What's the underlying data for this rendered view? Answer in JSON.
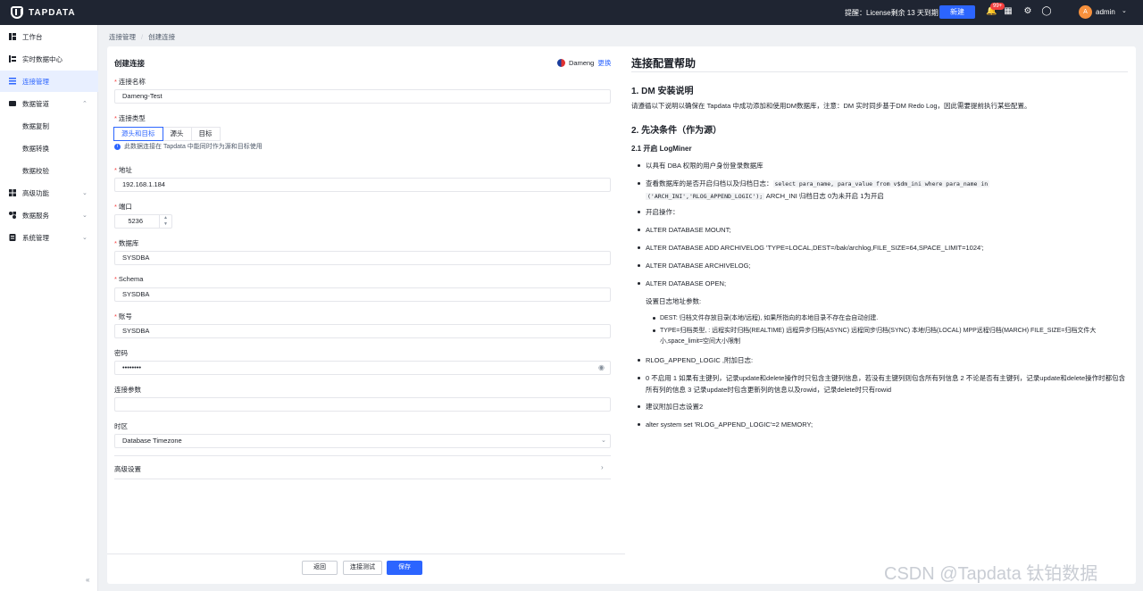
{
  "topbar": {
    "logo": "TAPDATA",
    "license": "提醒：License剩余 13 天到期",
    "new_label": "新建",
    "badge": "99+",
    "user": "admin",
    "avatar_letter": "A"
  },
  "sidebar": {
    "items": [
      {
        "label": "工作台"
      },
      {
        "label": "实时数据中心"
      },
      {
        "label": "连接管理"
      },
      {
        "label": "数据管道"
      },
      {
        "label": "数据复制"
      },
      {
        "label": "数据转换"
      },
      {
        "label": "数据校验"
      },
      {
        "label": "高级功能"
      },
      {
        "label": "数据服务"
      },
      {
        "label": "系统管理"
      }
    ]
  },
  "breadcrumb": [
    "连接管理",
    "创建连接"
  ],
  "form": {
    "title": "创建连接",
    "db_type": "Dameng",
    "change": "更换",
    "name_label": "连接名称",
    "name_value": "Dameng-Test",
    "type_label": "连接类型",
    "type_options": [
      "源头和目标",
      "源头",
      "目标"
    ],
    "type_hint": "此数据连接在 Tapdata 中能同时作为源和目标使用",
    "host_label": "地址",
    "host_value": "192.168.1.184",
    "port_label": "端口",
    "port_value": "5236",
    "db_label": "数据库",
    "db_value": "SYSDBA",
    "schema_label": "Schema",
    "schema_value": "SYSDBA",
    "user_label": "账号",
    "user_value": "SYSDBA",
    "pwd_label": "密码",
    "pwd_value": "••••••••",
    "params_label": "连接参数",
    "params_value": "",
    "tz_label": "时区",
    "tz_value": "Database Timezone",
    "advanced": "高级设置",
    "back": "返回",
    "test": "连接测试",
    "save": "保存"
  },
  "help": {
    "title": "连接配置帮助",
    "s1": "1. DM 安装说明",
    "s1p": "请遵循以下说明以确保在 Tapdata 中成功添加和使用DM数据库，注意：DM 实时同步基于DM Redo Log，因此需要提前执行某些配置。",
    "s2": "2. 先决条件（作为源）",
    "s21": "2.1 开启 LogMiner",
    "b1": "以具有 DBA 权限的用户身份登录数据库",
    "b2a": "查看数据库的是否开启归档以及归档日志：",
    "b2code": "select para_name, para_value from v$dm_ini where para_name in",
    "b2code2": "('ARCH_INI','RLOG_APPEND_LOGIC');",
    "b2b": " ARCH_INI 归档日志 0为未开启 1为开启",
    "b3": "开启操作：",
    "b4": "ALTER DATABASE MOUNT;",
    "b5": "ALTER DATABASE ADD ARCHIVELOG 'TYPE=LOCAL,DEST=/bak/archlog,FILE_SIZE=64,SPACE_LIMIT=1024';",
    "b6": "ALTER DATABASE ARCHIVELOG;",
    "b7": "ALTER DATABASE OPEN;",
    "p2": "设置日志地址参数:",
    "sb1": "DEST: 归档文件存放目录(本地/远程), 如果所指向的本地目录不存在会自动创建.",
    "sb2": "TYPE=归档类型, : 远程实时归档(REALTIME) 远程异步归档(ASYNC) 远程同步归档(SYNC) 本地归档(LOCAL) MPP远程归档(MARCH) FILE_SIZE=归档文件大小,space_limit=空间大小限制",
    "b8": "RLOG_APPEND_LOGIC ,附加日志:",
    "b9": "0 不启用 1 如果有主键列，记录update和delete操作时只包含主键列信息，若没有主键列则包含所有列信息 2 不论是否有主键列，记录update和delete操作时都包含所有列的信息 3 记录update时包含更新列的信息以及rowid，记录delete时只有rowid",
    "b10": "建议附加日志设置2",
    "b11": "alter system set 'RLOG_APPEND_LOGIC'=2 MEMORY;"
  },
  "watermark": "CSDN @Tapdata 钛铂数据"
}
